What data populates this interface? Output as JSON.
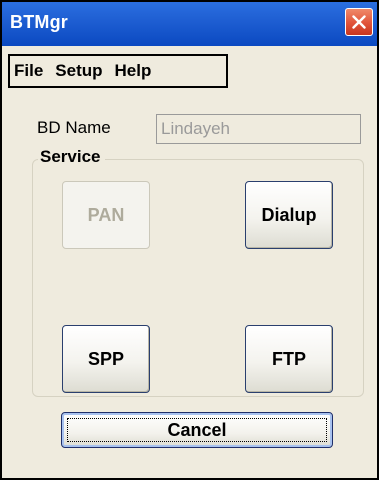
{
  "window": {
    "title": "BTMgr",
    "close_icon": "close-icon"
  },
  "menu": {
    "items": [
      {
        "label": "File"
      },
      {
        "label": "Setup"
      },
      {
        "label": "Help"
      }
    ]
  },
  "form": {
    "bd_name_label": "BD Name",
    "bd_name_value": "Lindayeh"
  },
  "service": {
    "legend": "Service",
    "buttons": {
      "pan": {
        "label": "PAN",
        "enabled": false
      },
      "dialup": {
        "label": "Dialup",
        "enabled": true
      },
      "spp": {
        "label": "SPP",
        "enabled": true
      },
      "ftp": {
        "label": "FTP",
        "enabled": true
      }
    }
  },
  "actions": {
    "cancel_label": "Cancel"
  },
  "colors": {
    "titlebar": "#0b49c1",
    "window_bg": "#efebde",
    "close_button": "#e0533a",
    "disabled_text": "#aeab9c"
  }
}
